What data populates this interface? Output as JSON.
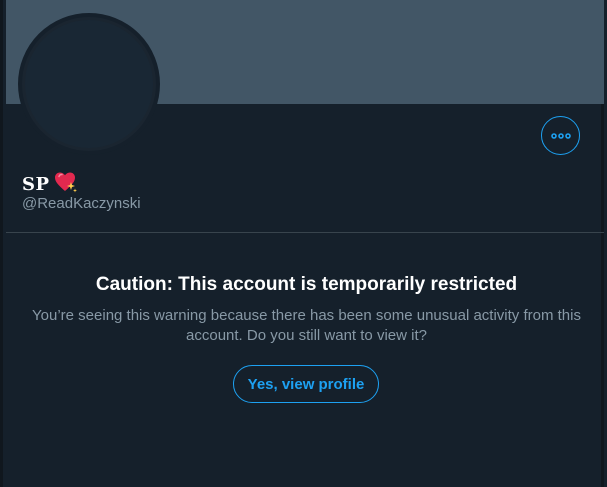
{
  "profile": {
    "display_name": "SP",
    "name_emoji_icon": "sparkling-heart-icon",
    "handle": "@ReadKaczynski",
    "more_icon": "more-horizontal-icon"
  },
  "warning": {
    "title": "Caution: This account is temporarily restricted",
    "body": "You’re seeing this warning because there has been some unusual activity from this account. Do you still want to view it?",
    "button_label": "Yes, view profile"
  },
  "colors": {
    "background": "#15202b",
    "banner": "#425666",
    "accent": "#1da1f2",
    "secondary_text": "#8899a6",
    "divider": "#38444d"
  }
}
